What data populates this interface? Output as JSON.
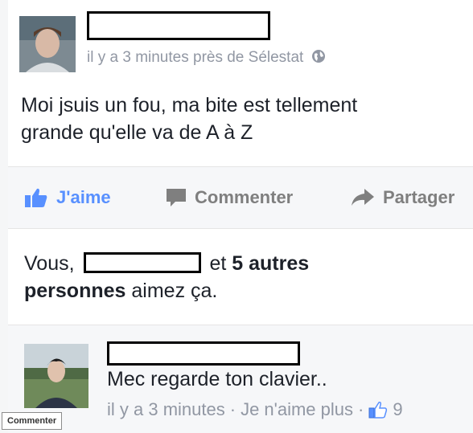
{
  "post": {
    "timestamp": "il y a 3 minutes près de Sélestat",
    "text_line1": "Moi jsuis un fou, ma bite est tellement",
    "text_line2": "grande qu'elle va de A à Z"
  },
  "actions": {
    "like_label": "J'aime",
    "comment_label": "Commenter",
    "share_label": "Partager"
  },
  "likes": {
    "prefix": "Vous,",
    "middle": "et",
    "bold_part1": "5 autres",
    "bold_part2": "personnes",
    "suffix": "aimez ça."
  },
  "comment": {
    "text": "Mec regarde ton clavier..",
    "timestamp": "il y a 3 minutes",
    "separator": "·",
    "unlike_label": "Je n'aime plus",
    "like_count": "9"
  },
  "tooltip": {
    "label": "Commenter"
  },
  "colors": {
    "accent": "#5890ff",
    "meta": "#9197a3",
    "text": "#1d2129"
  }
}
